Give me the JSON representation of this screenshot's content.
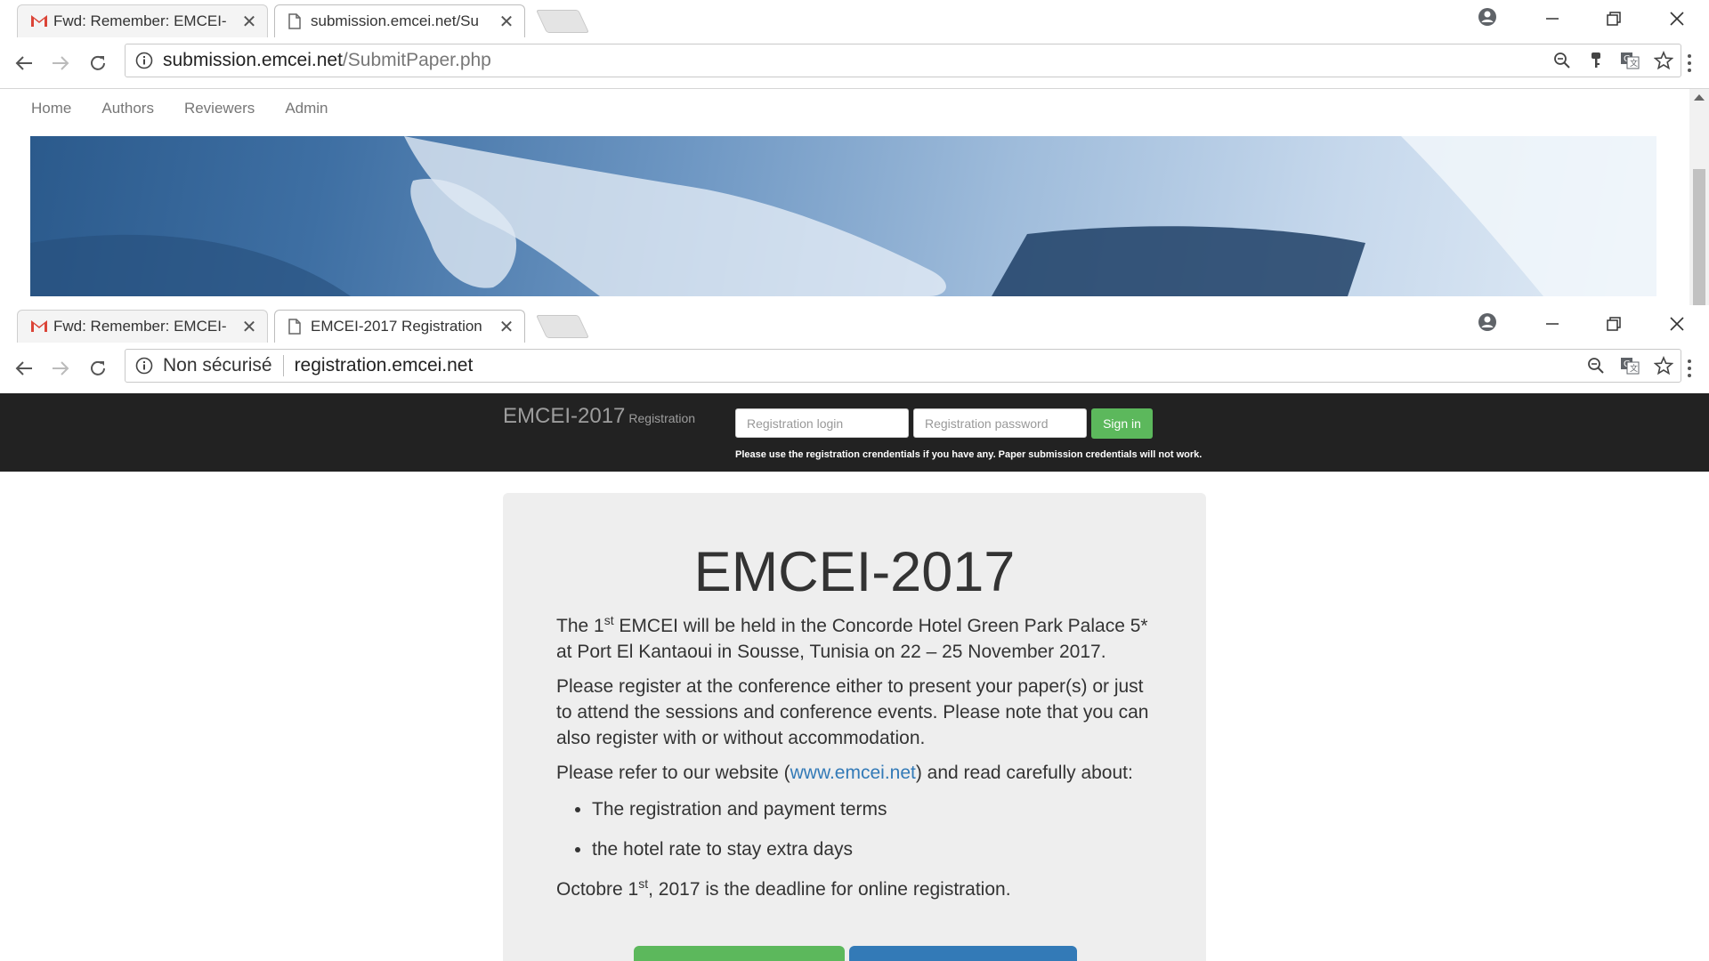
{
  "window1": {
    "tabs": [
      {
        "label": "Fwd: Remember: EMCEI-",
        "favicon": "gmail-icon"
      },
      {
        "label": "submission.emcei.net/Su",
        "favicon": "page-icon"
      }
    ],
    "url_host": "submission.emcei.net",
    "url_path": "/SubmitPaper.php",
    "nav": [
      "Home",
      "Authors",
      "Reviewers",
      "Admin"
    ]
  },
  "window2": {
    "tabs": [
      {
        "label": "Fwd: Remember: EMCEI-",
        "favicon": "gmail-icon"
      },
      {
        "label": "EMCEI-2017 Registration",
        "favicon": "page-icon"
      }
    ],
    "security_label": "Non sécurisé",
    "url_host": "registration.emcei.net",
    "brand": "EMCEI-2017",
    "brand_sub": "Registration",
    "login_placeholder": "Registration login",
    "password_placeholder": "Registration password",
    "signin_label": "Sign in",
    "login_note": "Please use the registration crendentials if you have any. Paper submission credentials will not work.",
    "heading": "EMCEI-2017",
    "intro_1a": "The 1",
    "intro_1_sup": "st",
    "intro_1b": " EMCEI will be held in the Concorde Hotel Green Park Palace 5* at Port El Kantaoui in Sousse, Tunisia on 22 – 25 November 2017.",
    "intro_2": "Please register at the conference either to present your paper(s) or just to attend the sessions and conference events. Please note that you can also register with or without accommodation.",
    "intro_3a": "Please refer to our website (",
    "website_link": "www.emcei.net",
    "intro_3b": ") and read carefully about:",
    "bullets": [
      "The registration and payment terms",
      "the hotel rate to stay extra days"
    ],
    "deadline_a": "Octobre 1",
    "deadline_sup": "st",
    "deadline_b": ", 2017 is the deadline for online registration."
  },
  "colors": {
    "navbar_bg": "#222222",
    "success": "#5cb85c",
    "primary": "#337ab7",
    "jumbotron_bg": "#eeeeee"
  }
}
